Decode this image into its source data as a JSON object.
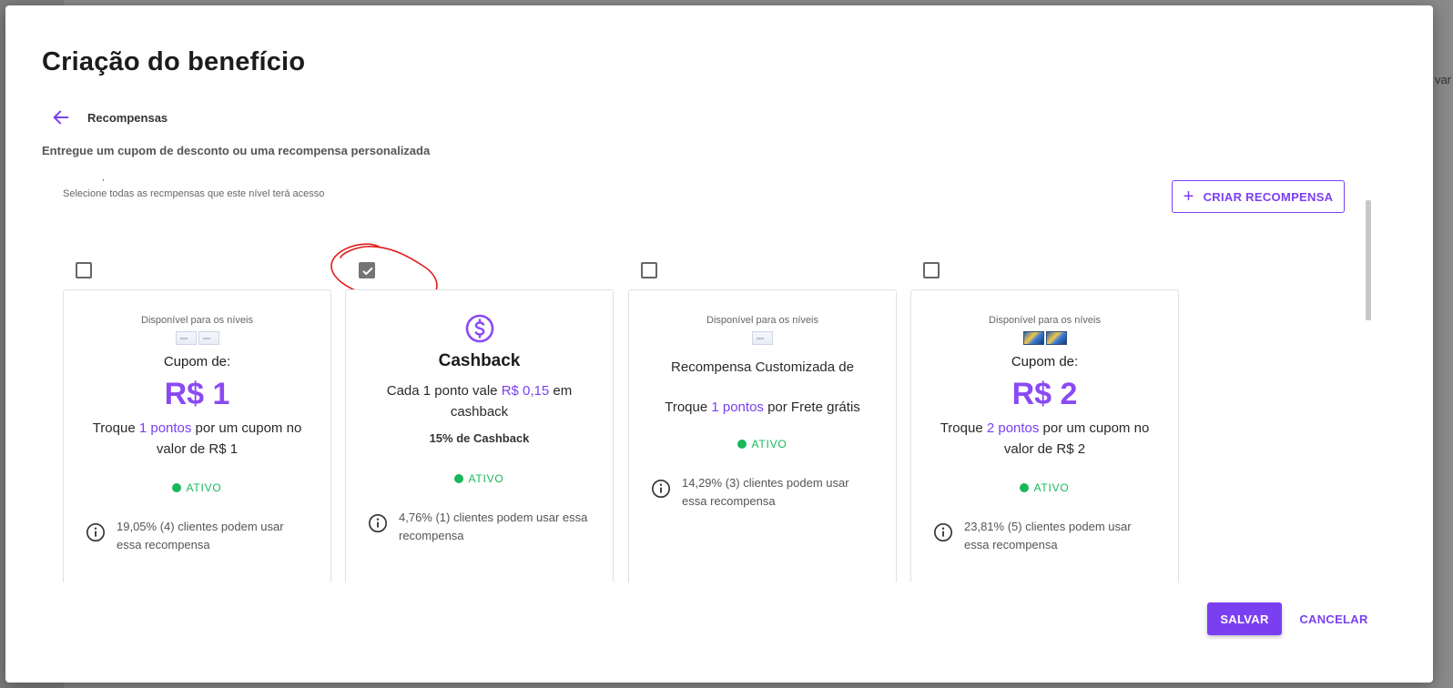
{
  "backdrop": {
    "right_text": "var"
  },
  "modal": {
    "title": "Criação do benefício",
    "back_label": "Recompensas",
    "subtitle": "Entregue um cupom de desconto ou uma recompensa personalizada",
    "stray_mark": ",",
    "helper_text": "Selecione todas as recmpensas que este nível terá acesso",
    "create_button": {
      "icon": "plus-icon",
      "label": "CRIAR RECOMPENSA"
    }
  },
  "colors": {
    "accent": "#7b3ff2",
    "value_purple": "#8a4af3",
    "active_green": "#18b85a",
    "annotation_red": "#e01b1b"
  },
  "cards": [
    {
      "checked": false,
      "available_label": "Disponível para os níveis",
      "coupon_label": "Cupom de:",
      "coupon_value": "R$ 1",
      "desc_pre": "Troque ",
      "desc_highlight": "1 pontos",
      "desc_post": " por um cupom no valor de R$ 1",
      "status": "ATIVO",
      "info": "19,05% (4) clientes podem usar essa recompensa"
    },
    {
      "checked": true,
      "icon": "dollar-circle-icon",
      "title": "Cashback",
      "desc_pre": "Cada 1 ponto vale ",
      "desc_highlight": "R$ 0,15",
      "desc_post": " em cashback",
      "sub": "15% de Cashback",
      "status": "ATIVO",
      "info": "4,76% (1) clientes podem usar essa recompensa"
    },
    {
      "checked": false,
      "available_label": "Disponível para os níveis",
      "title": "Recompensa Customizada de",
      "desc_pre": "Troque ",
      "desc_highlight": "1 pontos",
      "desc_post": " por Frete grátis",
      "status": "ATIVO",
      "info": "14,29% (3) clientes podem usar essa recompensa"
    },
    {
      "checked": false,
      "available_label": "Disponível para os níveis",
      "coupon_label": "Cupom de:",
      "coupon_value": "R$ 2",
      "desc_pre": "Troque ",
      "desc_highlight": "2 pontos",
      "desc_post": " por um cupom no valor de R$ 2",
      "status": "ATIVO",
      "info": "23,81% (5) clientes podem usar essa recompensa"
    }
  ],
  "footer": {
    "save_label": "SALVAR",
    "cancel_label": "CANCELAR"
  }
}
